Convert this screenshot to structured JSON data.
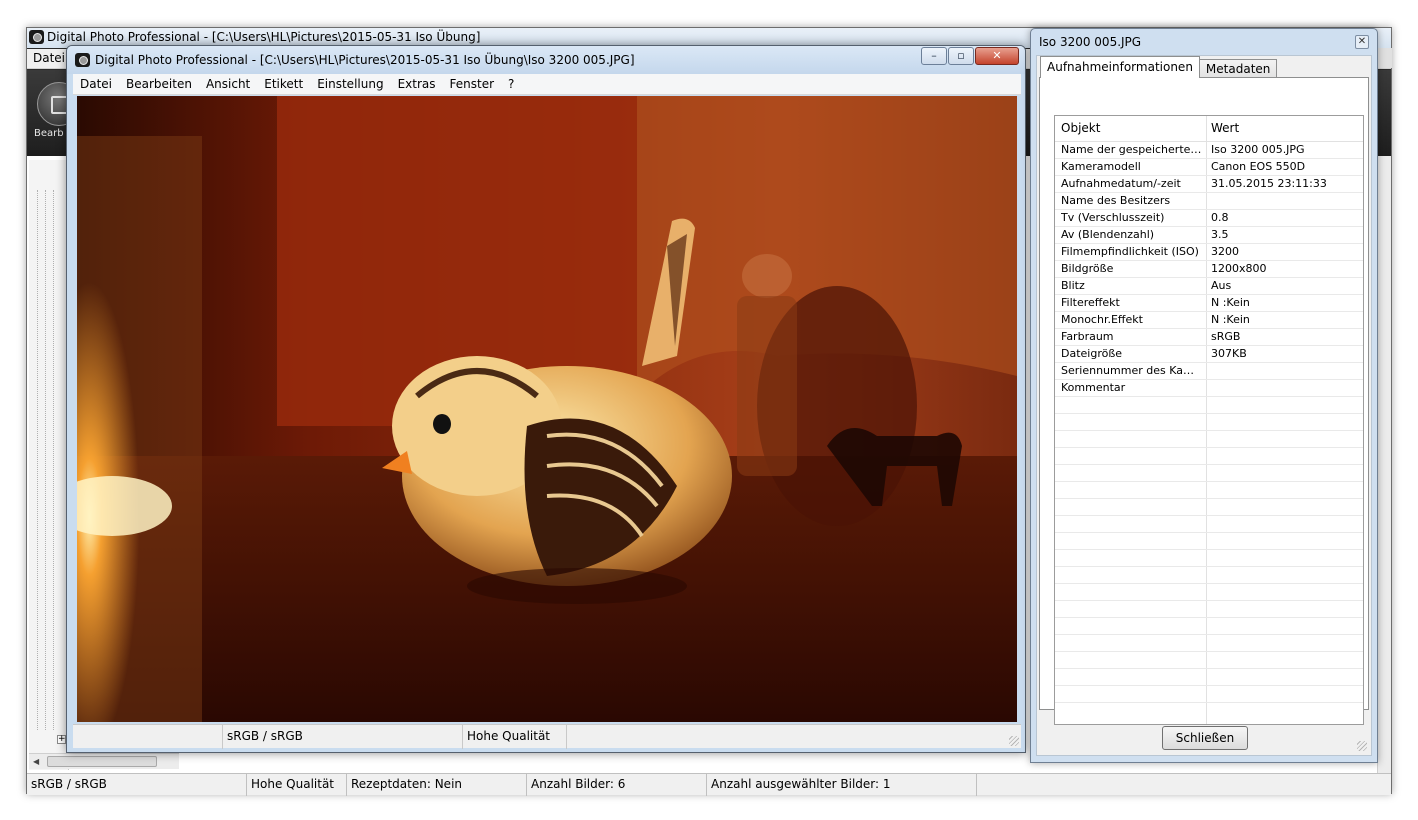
{
  "main_window": {
    "title": "Digital Photo Professional - [C:\\Users\\HL\\Pictures\\2015-05-31 Iso Übung]",
    "menu_first": "Datei",
    "toolbar_edit_label": "Bearb fenst",
    "status": [
      "sRGB / sRGB",
      "Hohe Qualität",
      "Rezeptdaten: Nein",
      "Anzahl Bilder: 6",
      "Anzahl ausgewählter Bilder: 1"
    ]
  },
  "viewer_window": {
    "title": "Digital Photo Professional - [C:\\Users\\HL\\Pictures\\2015-05-31 Iso Übung\\Iso 3200   005.JPG]",
    "menu": [
      "Datei",
      "Bearbeiten",
      "Ansicht",
      "Etikett",
      "Einstellung",
      "Extras",
      "Fenster",
      "?"
    ],
    "status": [
      "sRGB / sRGB",
      "Hohe Qualität"
    ],
    "photo_subject": "bird figurine by candlelight"
  },
  "info_dialog": {
    "title": "Iso 3200   005.JPG",
    "tabs": [
      "Aufnahmeinformationen",
      "Metadaten"
    ],
    "columns": [
      "Objekt",
      "Wert"
    ],
    "rows": [
      {
        "key": "Name der gespeicherten D...",
        "value": "Iso 3200   005.JPG"
      },
      {
        "key": "Kameramodell",
        "value": "Canon EOS 550D"
      },
      {
        "key": "Aufnahmedatum/-zeit",
        "value": "31.05.2015 23:11:33"
      },
      {
        "key": "Name des Besitzers",
        "value": ""
      },
      {
        "key": "Tv (Verschlusszeit)",
        "value": "0.8"
      },
      {
        "key": "Av (Blendenzahl)",
        "value": "3.5"
      },
      {
        "key": "Filmempfindlichkeit (ISO)",
        "value": "3200"
      },
      {
        "key": "Bildgröße",
        "value": "1200x800"
      },
      {
        "key": "Blitz",
        "value": "Aus"
      },
      {
        "key": "Filtereffekt",
        "value": "N :Kein"
      },
      {
        "key": "Monochr.Effekt",
        "value": "N :Kein"
      },
      {
        "key": "Farbraum",
        "value": "sRGB"
      },
      {
        "key": "Dateigröße",
        "value": "307KB"
      },
      {
        "key": "Seriennummer des Kamera...",
        "value": ""
      },
      {
        "key": "Kommentar",
        "value": ""
      }
    ],
    "empty_rows": 18,
    "close_button": "Schließen"
  },
  "colors": {
    "photo_dark": "#3a0c02",
    "photo_warm": "#d8601a",
    "candle_glow": "#ffd27a",
    "titlebar_blue": "#c9dcef"
  }
}
